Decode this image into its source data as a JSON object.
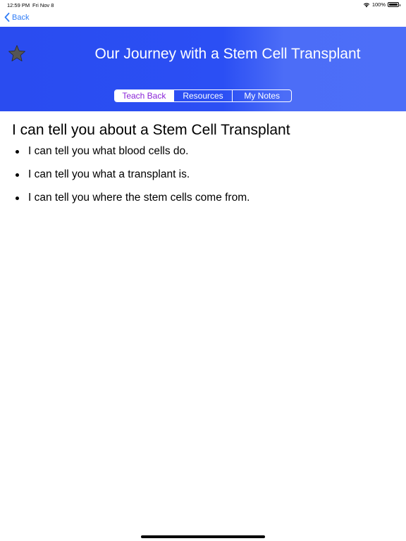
{
  "status_bar": {
    "time": "12:59 PM",
    "date": "Fri Nov 8",
    "battery": "100%"
  },
  "nav": {
    "back_label": "Back"
  },
  "header": {
    "title": "Our Journey with a Stem Cell Transplant",
    "segments": [
      {
        "label": "Teach Back",
        "selected": true
      },
      {
        "label": "Resources",
        "selected": false
      },
      {
        "label": "My Notes",
        "selected": false
      }
    ]
  },
  "content": {
    "heading": "I can tell you about a Stem Cell Transplant",
    "bullets": [
      "I can tell you what blood cells do.",
      "I can tell you what a transplant is.",
      "I can tell you where the stem cells come from."
    ]
  },
  "icons": {
    "star": "star-icon",
    "back": "chevron-left-icon",
    "wifi": "wifi-icon",
    "battery": "battery-icon"
  },
  "colors": {
    "header_blue": "#2a4cf0",
    "header_blue_light": "#4d6ef8",
    "accent_link": "#2f7cf6",
    "selected_segment_text": "#8a24d8",
    "star_fill": "#555555"
  }
}
